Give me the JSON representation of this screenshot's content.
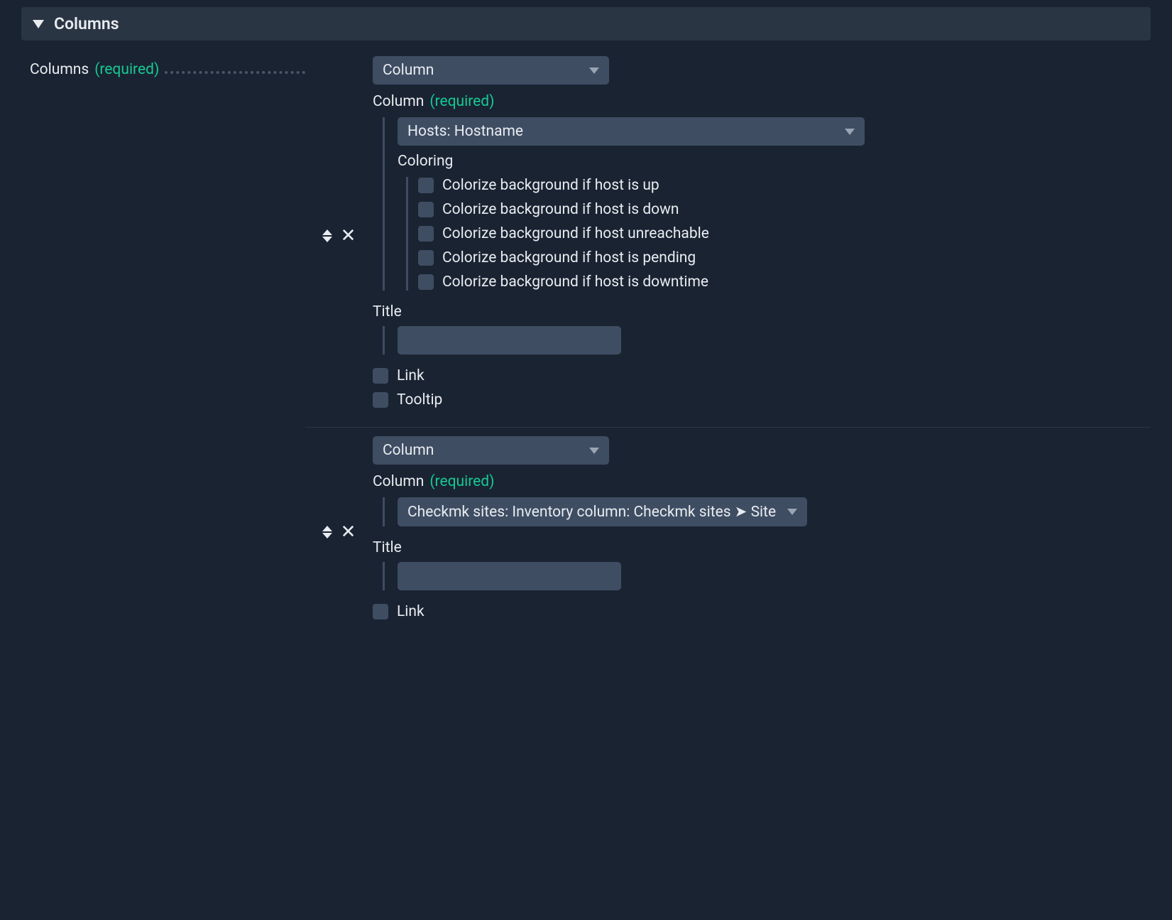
{
  "section": {
    "title": "Columns"
  },
  "row": {
    "label": "Columns",
    "required_text": "(required)"
  },
  "labels": {
    "column_type": "Column",
    "column_required": "Column",
    "required": "(required)",
    "coloring": "Coloring",
    "title": "Title",
    "link": "Link",
    "tooltip": "Tooltip"
  },
  "columns": [
    {
      "type_select": "Column",
      "column_select": "Hosts: Hostname",
      "coloring_options": [
        "Colorize background if host is up",
        "Colorize background if host is down",
        "Colorize background if host unreachable",
        "Colorize background if host is pending",
        "Colorize background if host is downtime"
      ],
      "title_value": "",
      "show_link": true,
      "show_tooltip": true
    },
    {
      "type_select": "Column",
      "column_select": "Checkmk sites: Inventory column: Checkmk sites ➤ Site",
      "title_value": "",
      "show_link": true,
      "show_tooltip": false
    }
  ]
}
